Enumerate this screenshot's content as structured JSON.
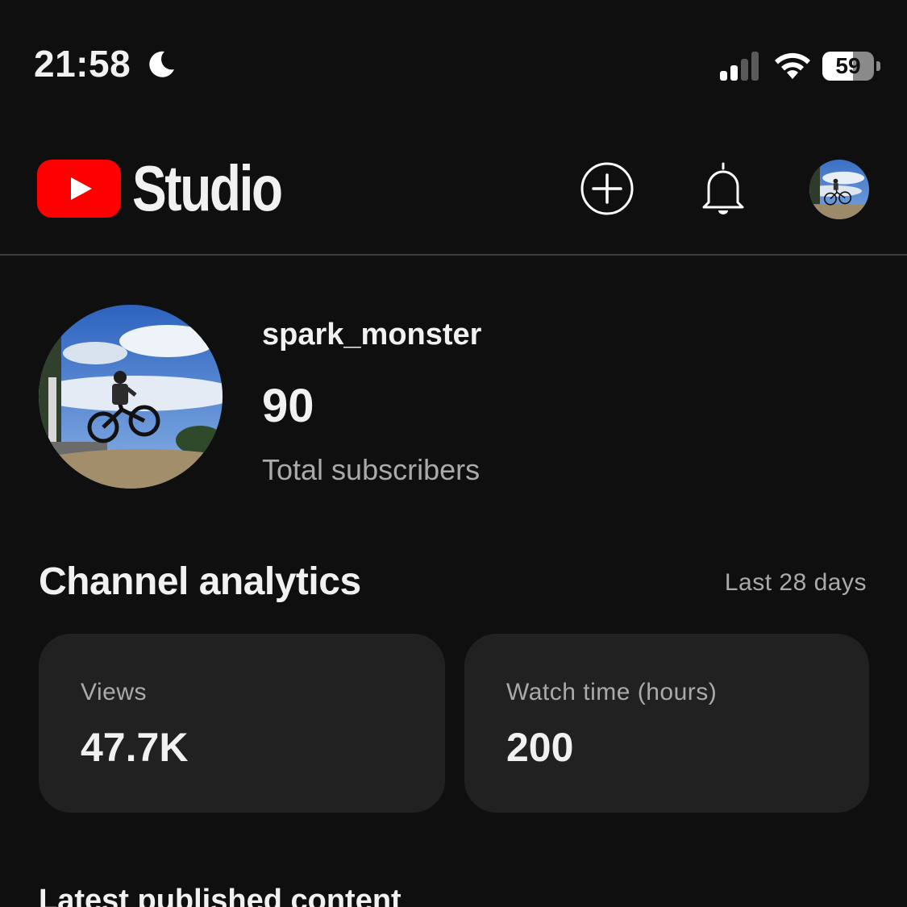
{
  "status_bar": {
    "time": "21:58",
    "focus_icon": "moon-icon",
    "signal_icon": "cellular-signal-icon",
    "wifi_icon": "wifi-icon",
    "battery_percent": "59"
  },
  "header": {
    "brand_name": "Studio",
    "logo_icon": "youtube-play-logo",
    "create_icon": "plus-circle-icon",
    "notifications_icon": "bell-icon",
    "account_icon": "profile-avatar"
  },
  "channel": {
    "name": "spark_monster",
    "subscriber_count": "90",
    "subscriber_label": "Total subscribers"
  },
  "analytics": {
    "title": "Channel analytics",
    "range": "Last 28 days",
    "cards": [
      {
        "label": "Views",
        "value": "47.7K"
      },
      {
        "label": "Watch time (hours)",
        "value": "200"
      }
    ]
  },
  "latest": {
    "title": "Latest published content"
  },
  "colors": {
    "background": "#0f0f0f",
    "card": "#212121",
    "brand_red": "#ff0000",
    "muted_text": "#aaaaaa"
  }
}
